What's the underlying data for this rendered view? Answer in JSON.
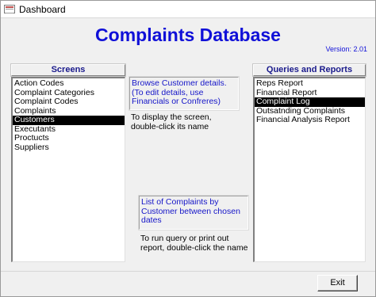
{
  "window": {
    "title": "Dashboard",
    "icon": "database-form-icon"
  },
  "header": {
    "title": "Complaints Database",
    "version": "Version: 2.01"
  },
  "screens": {
    "heading": "Screens",
    "items": [
      {
        "label": "Action Codes",
        "selected": false
      },
      {
        "label": "Complaint Categories",
        "selected": false
      },
      {
        "label": "Complaint Codes",
        "selected": false
      },
      {
        "label": "Complaints",
        "selected": false
      },
      {
        "label": "Customers",
        "selected": true
      },
      {
        "label": "Executants",
        "selected": false
      },
      {
        "label": "Proctucts",
        "selected": false
      },
      {
        "label": "Suppliers",
        "selected": false
      }
    ]
  },
  "screen_info": {
    "description": "Browse Customer details.  (To edit details, use Financials or Confreres)",
    "hint": "To display the screen, double-click its name"
  },
  "report_info": {
    "description": "List of Complaints by Customer between chosen dates",
    "hint": "To run query or print out report, double-click the name"
  },
  "reports": {
    "heading": "Queries and Reports",
    "items": [
      {
        "label": "Reps Report",
        "selected": false
      },
      {
        "label": "Financial Report",
        "selected": false
      },
      {
        "label": "Complaint Log",
        "selected": true
      },
      {
        "label": "Outsatnding Complaints",
        "selected": false
      },
      {
        "label": "Financial Analysis Report",
        "selected": false
      }
    ]
  },
  "footer": {
    "exit_label": "Exit"
  },
  "colors": {
    "title_blue": "#1010d8",
    "info_blue": "#1515c8",
    "selection": "#000000"
  }
}
